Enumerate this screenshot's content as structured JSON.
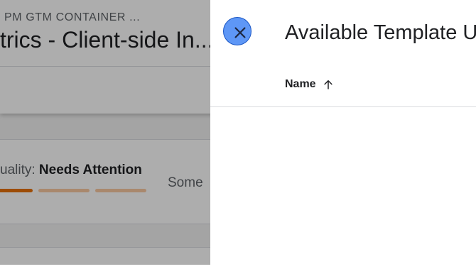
{
  "background": {
    "container_label": "PM GTM CONTAINER ...",
    "container_title": "trics - Client-side In...",
    "quality": {
      "prefix": "uality: ",
      "value": "Needs Attention",
      "description": "Some",
      "bars": [
        {
          "state": "filled",
          "color": "#e8710a"
        },
        {
          "state": "empty",
          "color": "#f9c9a1"
        },
        {
          "state": "empty",
          "color": "#f9c9a1"
        }
      ]
    }
  },
  "panel": {
    "title": "Available Template U",
    "close_icon": "close-icon",
    "table": {
      "columns": [
        {
          "label": "Name",
          "sort": "ascending",
          "sort_icon": "arrow-up-icon"
        }
      ],
      "rows": []
    }
  },
  "colors": {
    "accent": "#4285f4",
    "warning": "#e8710a"
  }
}
